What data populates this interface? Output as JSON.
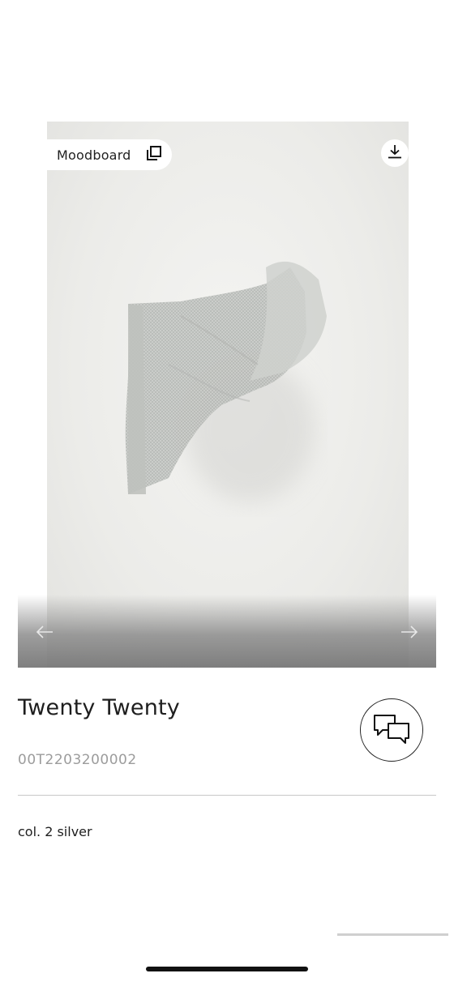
{
  "gallery": {
    "moodboard_label": "Moodboard"
  },
  "product": {
    "title": "Twenty Twenty",
    "code": "00T2203200002",
    "color": "col. 2 silver"
  },
  "icons": {
    "moodboard": "layers-icon",
    "download": "download-icon",
    "prev": "arrow-left-icon",
    "next": "arrow-right-icon",
    "chat": "chat-bubbles-icon"
  }
}
